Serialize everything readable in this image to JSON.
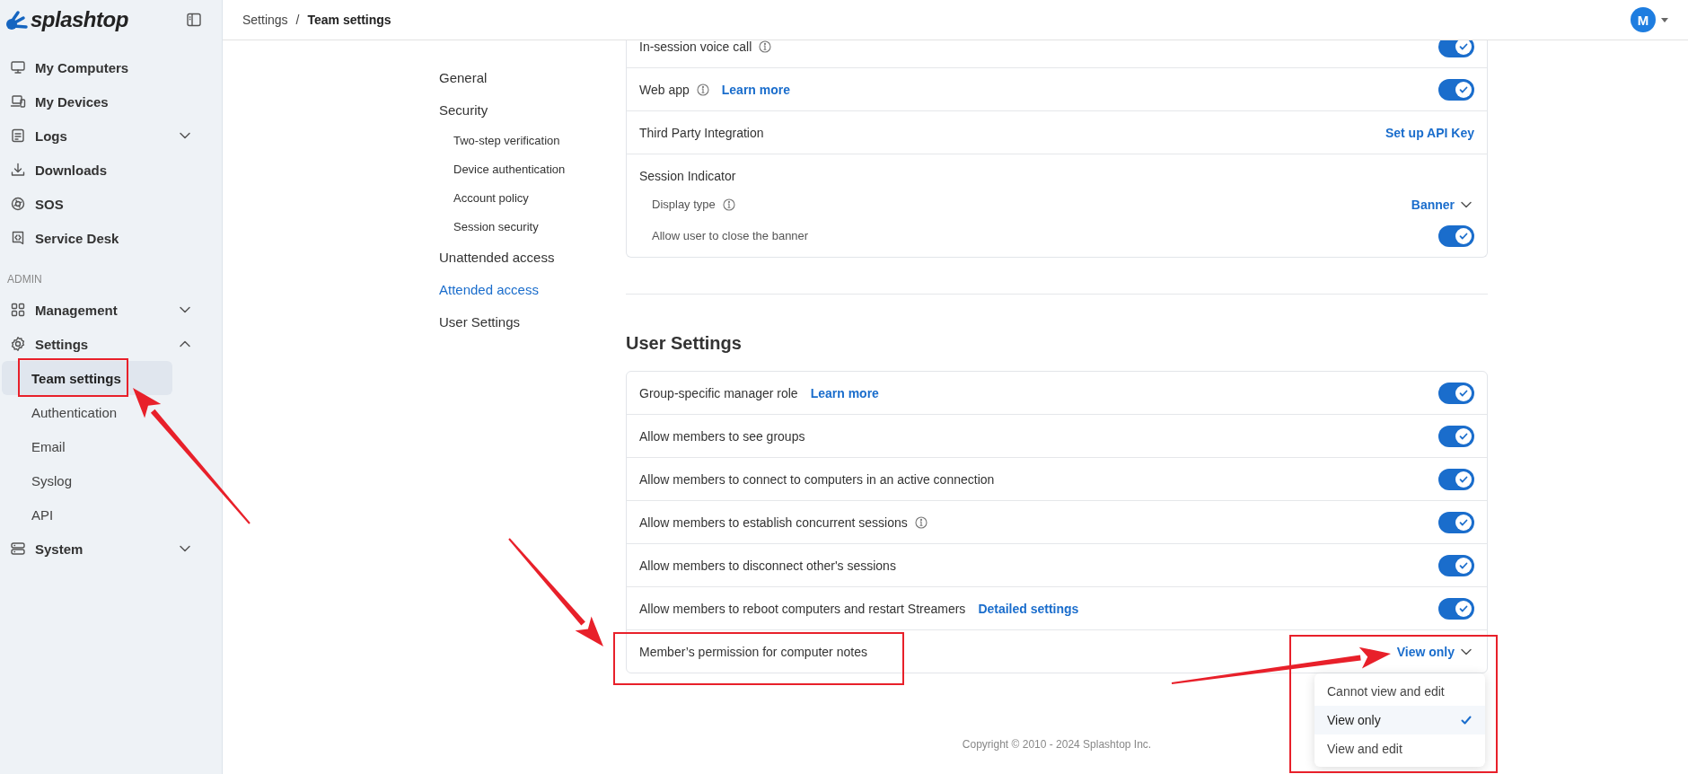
{
  "sidebar": {
    "logo": "splashtop",
    "groups": [
      {
        "items": [
          {
            "label": "My Computers",
            "selected": false
          },
          {
            "label": "My Devices",
            "selected": false
          },
          {
            "label": "Logs",
            "selected": false,
            "expanded": false
          },
          {
            "label": "Downloads",
            "selected": false
          },
          {
            "label": "SOS",
            "selected": false
          },
          {
            "label": "Service Desk",
            "selected": false
          }
        ]
      },
      {
        "label": "ADMIN",
        "items": [
          {
            "label": "Management",
            "selected": false,
            "expanded": false
          },
          {
            "label": "Settings",
            "selected": false,
            "expanded": true,
            "children": [
              {
                "label": "Team settings",
                "selected": true
              },
              {
                "label": "Authentication",
                "selected": false
              },
              {
                "label": "Email",
                "selected": false
              },
              {
                "label": "Syslog",
                "selected": false
              },
              {
                "label": "API",
                "selected": false
              }
            ]
          },
          {
            "label": "System",
            "selected": false,
            "expanded": false
          }
        ]
      }
    ]
  },
  "header": {
    "breadcrumb": [
      "Settings",
      "Team settings"
    ],
    "separator": "/",
    "avatar": "M"
  },
  "settings_nav": [
    {
      "label": "General",
      "selected": false
    },
    {
      "label": "Security",
      "selected": false,
      "children": [
        {
          "label": "Two-step verification",
          "selected": false
        },
        {
          "label": "Device authentication",
          "selected": false
        },
        {
          "label": "Account policy",
          "selected": false
        },
        {
          "label": "Session security",
          "selected": false
        }
      ]
    },
    {
      "label": "Unattended access",
      "selected": false
    },
    {
      "label": "Attended access",
      "selected": true
    },
    {
      "label": "User Settings",
      "selected": false
    }
  ],
  "attended_access": {
    "rows": [
      {
        "kind": "toggle",
        "label": "In-session voice call",
        "info": true,
        "on": true
      },
      {
        "kind": "toggle",
        "label": "Web app",
        "info": true,
        "link": "Learn more",
        "on": true
      },
      {
        "kind": "action",
        "label": "Third Party Integration",
        "action": "Set up API Key"
      },
      {
        "kind": "group",
        "label": "Session Indicator",
        "children": [
          {
            "kind": "select",
            "label": "Display type",
            "info": true,
            "value": "Banner"
          },
          {
            "kind": "toggle",
            "label": "Allow user to close the banner",
            "on": true
          }
        ]
      }
    ]
  },
  "user_settings": {
    "title": "User Settings",
    "rows": [
      {
        "kind": "toggle",
        "label": "Group-specific manager role",
        "link": "Learn more",
        "on": true
      },
      {
        "kind": "toggle",
        "label": "Allow members to see groups",
        "on": true
      },
      {
        "kind": "toggle",
        "label": "Allow members to connect to computers in an active connection",
        "on": true
      },
      {
        "kind": "toggle",
        "label": "Allow members to establish concurrent sessions",
        "info": true,
        "on": true
      },
      {
        "kind": "toggle",
        "label": "Allow members to disconnect other's sessions",
        "on": true
      },
      {
        "kind": "toggle",
        "label": "Allow members to reboot computers and restart Streamers",
        "link": "Detailed settings",
        "on": true
      },
      {
        "kind": "select",
        "label": "Member’s permission for computer notes",
        "value": "View only",
        "expanded": true,
        "options": [
          {
            "label": "Cannot view and edit",
            "selected": false
          },
          {
            "label": "View only",
            "selected": true
          },
          {
            "label": "View and edit",
            "selected": false
          }
        ]
      }
    ]
  },
  "footer": {
    "copyright": "Copyright © 2010 - 2024 Splashtop Inc."
  }
}
